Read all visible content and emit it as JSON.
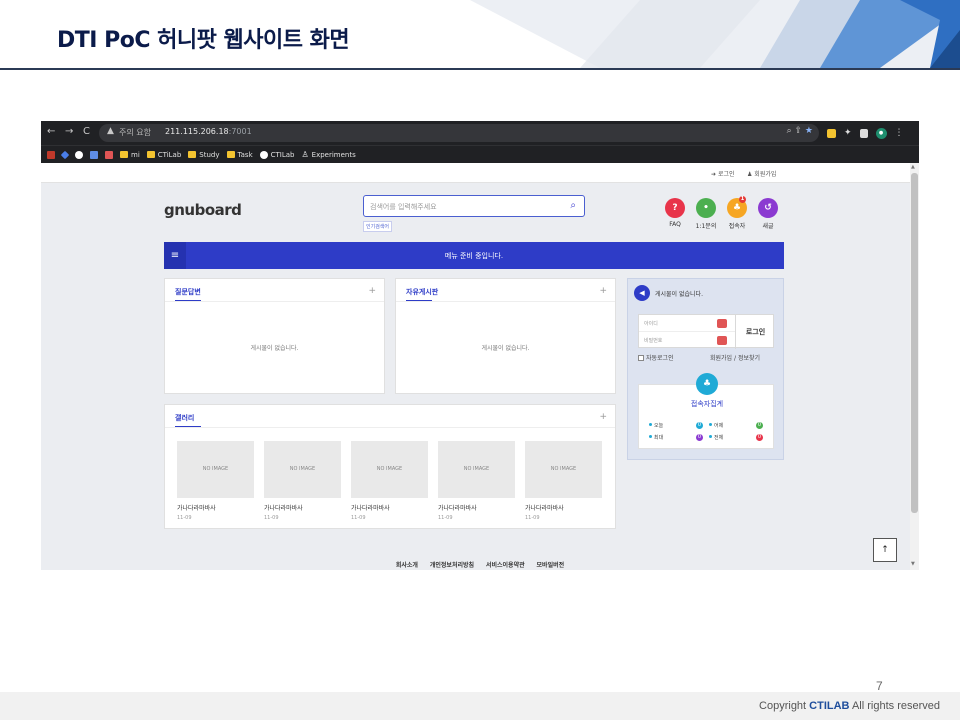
{
  "slide": {
    "title": "DTI PoC 허니팟 웹사이트 화면",
    "page_number": "7",
    "copyright_prefix": "Copyright",
    "copyright_brand": "CTILAB",
    "copyright_suffix": "All rights reserved"
  },
  "browser": {
    "security_label": "주의 요함",
    "url_host": "211.115.206.18",
    "url_port": ":7001",
    "bookmarks": [
      "mi",
      "CTiLab",
      "Study",
      "Task",
      "CTILab",
      "Experiments"
    ]
  },
  "site": {
    "top_links": {
      "login": "로그인",
      "register": "회원가입"
    },
    "logo": "gnuboard",
    "search_placeholder": "검색어를 입력해주세요",
    "popular_tag": "인기검색어",
    "quick": [
      {
        "label": "FAQ",
        "symbol": "?",
        "color": "#e8344a"
      },
      {
        "label": "1:1문의",
        "symbol": "•",
        "color": "#4caf50"
      },
      {
        "label": "접속자",
        "symbol": "♣",
        "color": "#f6a623",
        "badge": "1"
      },
      {
        "label": "새글",
        "symbol": "↺",
        "color": "#8b3ad1"
      }
    ],
    "menu_text": "메뉴 준비 중입니다.",
    "board_qa": {
      "title": "질문답변",
      "empty": "게시물이 없습니다."
    },
    "board_free": {
      "title": "자유게시판",
      "empty": "게시물이 없습니다."
    },
    "gallery": {
      "title": "갤러리",
      "items": [
        {
          "img": "NO IMAGE",
          "name": "가나다라마바사",
          "date": "11-09"
        },
        {
          "img": "NO IMAGE",
          "name": "가나다라마바사",
          "date": "11-09"
        },
        {
          "img": "NO IMAGE",
          "name": "가나다라마바사",
          "date": "11-09"
        },
        {
          "img": "NO IMAGE",
          "name": "가나다라마바사",
          "date": "11-09"
        },
        {
          "img": "NO IMAGE",
          "name": "가나다라마바사",
          "date": "11-09"
        }
      ]
    },
    "side": {
      "notice": "게시물이 없습니다.",
      "id_placeholder": "아이디",
      "pw_placeholder": "비밀번호",
      "login_button": "로그인",
      "auto_login": "자동로그인",
      "register": "회원가입",
      "separator": "/",
      "find_info": "정보찾기",
      "visit_title": "접속자집계",
      "today": "오늘",
      "today_val": "0",
      "yesterday": "어제",
      "yesterday_val": "0",
      "max": "최대",
      "max_val": "0",
      "total": "전체",
      "total_val": "0"
    },
    "footer": [
      "회사소개",
      "개인정보처리방침",
      "서비스이용약관",
      "모바일버전"
    ]
  },
  "colors": {
    "title_navy": "#0b1b4a",
    "menu_blue": "#2e3cc7",
    "accent_teal": "#1faad6"
  }
}
